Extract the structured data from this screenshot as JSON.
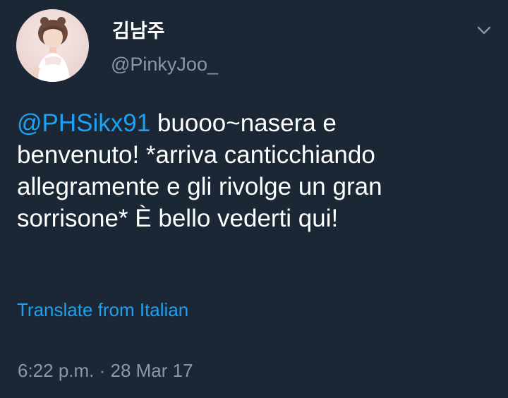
{
  "tweet": {
    "display_name": "김남주",
    "handle": "@PinkyJoo_",
    "mention": "@PHSikx91",
    "text_line1": " buooo~nasera e",
    "text_line2": "benvenuto! *arriva canticchiando",
    "text_line3": "allegramente e gli rivolge un gran",
    "text_line4": "sorrisone* È bello vederti qui!",
    "translate_label": "Translate from Italian",
    "timestamp": "6:22 p.m. · 28 Mar 17"
  },
  "colors": {
    "background": "#1b2734",
    "link": "#1da1f2",
    "secondary_text": "#8899a6",
    "primary_text": "#ffffff"
  },
  "icons": {
    "menu": "chevron-down-icon",
    "avatar": "profile-photo"
  }
}
